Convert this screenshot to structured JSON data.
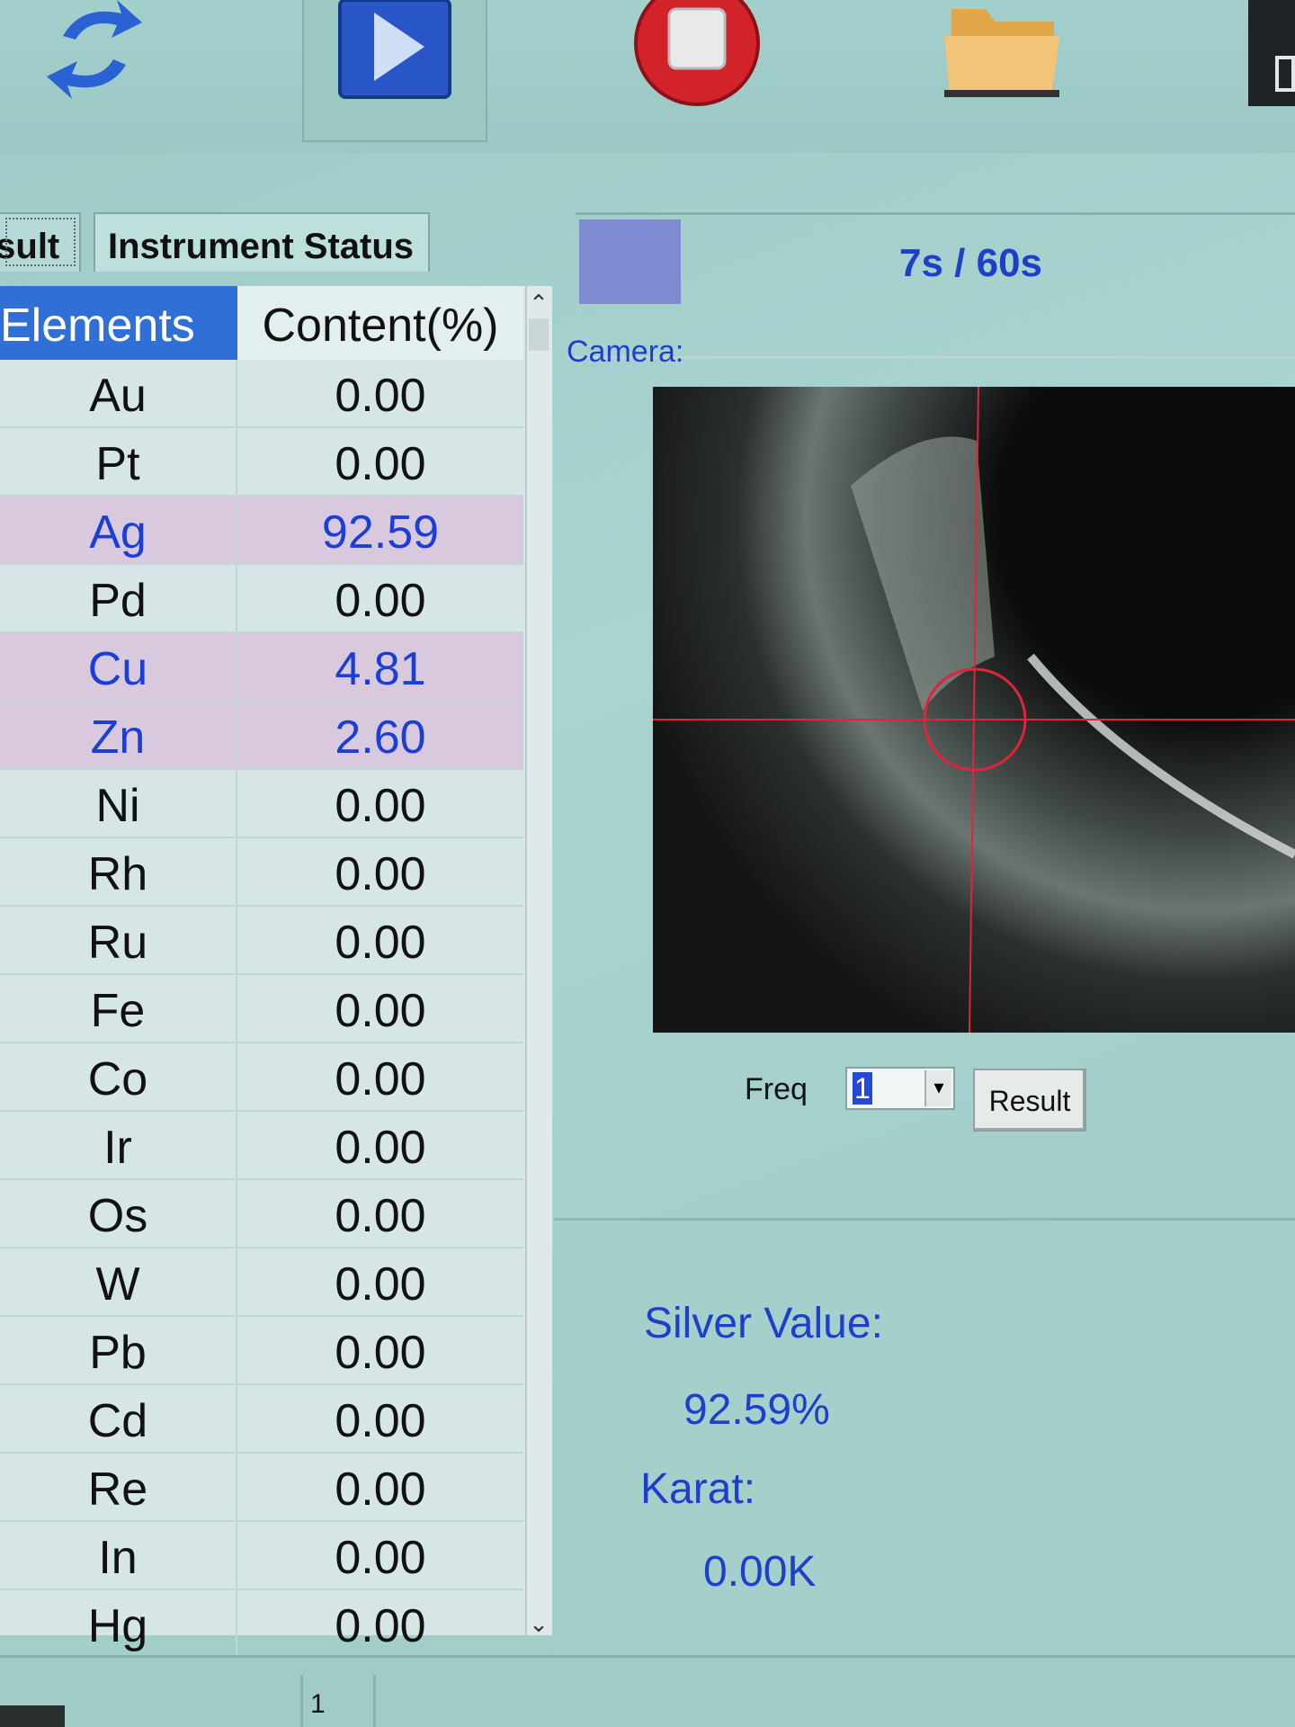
{
  "tabs": {
    "result": "Result",
    "status": "Instrument Status"
  },
  "timer": {
    "text": "7s / 60s",
    "progress_fraction": 0.117
  },
  "table": {
    "headers": [
      "Elements",
      "Content(%)"
    ],
    "rows": [
      {
        "el": "Au",
        "val": "0.00",
        "hl": false
      },
      {
        "el": "Pt",
        "val": "0.00",
        "hl": false
      },
      {
        "el": "Ag",
        "val": "92.59",
        "hl": true
      },
      {
        "el": "Pd",
        "val": "0.00",
        "hl": false
      },
      {
        "el": "Cu",
        "val": "4.81",
        "hl": true
      },
      {
        "el": "Zn",
        "val": "2.60",
        "hl": true
      },
      {
        "el": "Ni",
        "val": "0.00",
        "hl": false
      },
      {
        "el": "Rh",
        "val": "0.00",
        "hl": false
      },
      {
        "el": "Ru",
        "val": "0.00",
        "hl": false
      },
      {
        "el": "Fe",
        "val": "0.00",
        "hl": false
      },
      {
        "el": "Co",
        "val": "0.00",
        "hl": false
      },
      {
        "el": "Ir",
        "val": "0.00",
        "hl": false
      },
      {
        "el": "Os",
        "val": "0.00",
        "hl": false
      },
      {
        "el": "W",
        "val": "0.00",
        "hl": false
      },
      {
        "el": "Pb",
        "val": "0.00",
        "hl": false
      },
      {
        "el": "Cd",
        "val": "0.00",
        "hl": false
      },
      {
        "el": "Re",
        "val": "0.00",
        "hl": false
      },
      {
        "el": "In",
        "val": "0.00",
        "hl": false
      },
      {
        "el": "Hg",
        "val": "0.00",
        "hl": false
      }
    ]
  },
  "camera": {
    "label": "Camera:"
  },
  "controls": {
    "freq_label": "Freq",
    "freq_value": "1",
    "result_button": "Result"
  },
  "results": {
    "silver_label": "Silver Value:",
    "silver_value": "92.59%",
    "karat_label": "Karat:",
    "karat_value": "0.00K"
  },
  "statusbar": {
    "cell": "1"
  },
  "icons": {
    "refresh": "refresh-icon",
    "play": "play-icon",
    "stop": "stop-icon",
    "folder": "folder-icon"
  },
  "colors": {
    "accent_blue": "#1e3fcc",
    "header_blue": "#2f6fd6",
    "highlight_row": "#d9c9de",
    "background": "#a4cfcb"
  }
}
